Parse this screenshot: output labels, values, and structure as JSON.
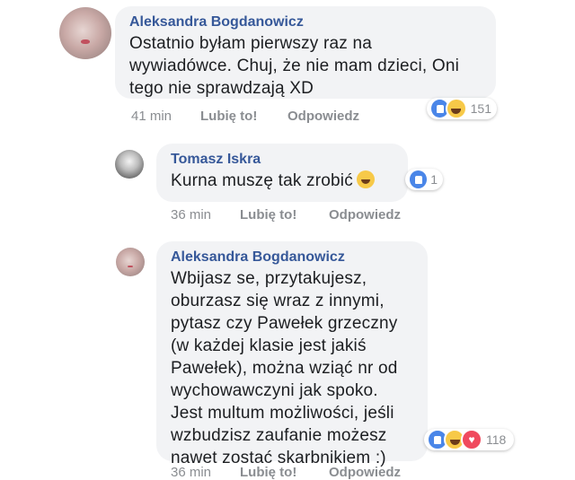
{
  "comments": [
    {
      "author": "Aleksandra Bogdanowicz",
      "lines": [
        "Ostatnio byłam pierwszy raz na",
        "wywiadówce. Chuj, że nie mam dzieci, Oni",
        "tego nie sprawdzają XD"
      ],
      "time": "41 min",
      "like_label": "Lubię to!",
      "reply_label": "Odpowiedz",
      "reactions": [
        "like-icon",
        "haha-icon"
      ],
      "reaction_count": "151"
    },
    {
      "author": "Tomasz Iskra",
      "lines": [
        "Kurna muszę tak zrobić"
      ],
      "emoji": "laughing-emoji",
      "time": "36 min",
      "like_label": "Lubię to!",
      "reply_label": "Odpowiedz",
      "reactions": [
        "like-icon"
      ],
      "reaction_count": "1"
    },
    {
      "author": "Aleksandra Bogdanowicz",
      "lines": [
        "Wbijasz se, przytakujesz,",
        "oburzasz się wraz z innymi,",
        "pytasz czy Pawełek grzeczny",
        "(w każdej klasie jest jakiś",
        "Pawełek), można wziąć nr od",
        "wychowawczyni jak spoko.",
        "Jest multum możliwości, jeśli",
        "wzbudzisz zaufanie możesz",
        "nawet zostać skarbnikiem :)"
      ],
      "time": "36 min",
      "like_label": "Lubię to!",
      "reply_label": "Odpowiedz",
      "reactions": [
        "like-icon",
        "haha-icon",
        "love-icon"
      ],
      "reaction_count": "118"
    }
  ],
  "colors": {
    "author": "#365899",
    "bubble": "#f2f3f5",
    "meta": "#8a8d91",
    "like": "#4a86e8",
    "love": "#f04a5e",
    "haha": "#f7c948"
  }
}
